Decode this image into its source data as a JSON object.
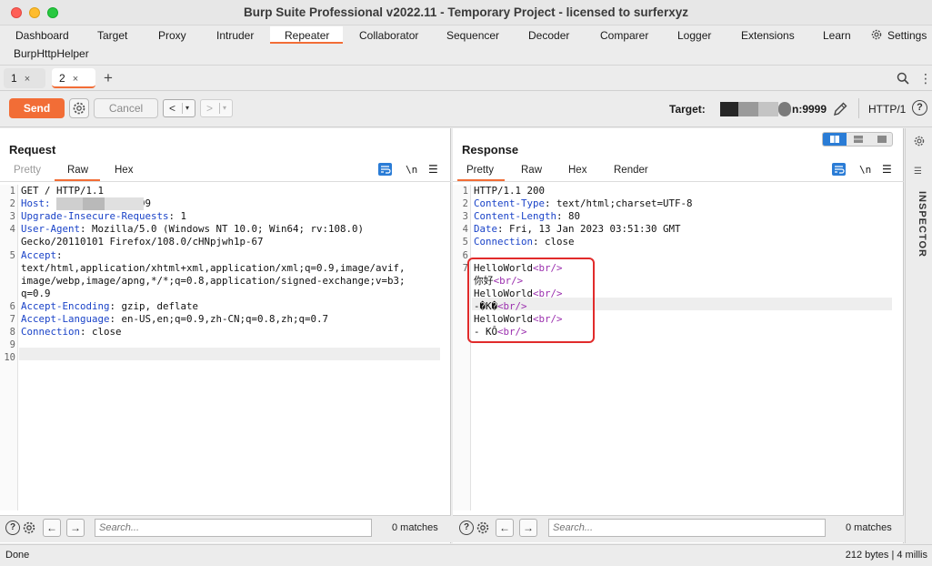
{
  "window": {
    "title": "Burp Suite Professional v2022.11 - Temporary Project - licensed to surferxyz"
  },
  "menu": {
    "tabs": [
      "Dashboard",
      "Target",
      "Proxy",
      "Intruder",
      "Repeater",
      "Collaborator",
      "Sequencer",
      "Decoder",
      "Comparer",
      "Logger",
      "Extensions",
      "Learn"
    ],
    "active": "Repeater",
    "settings_label": "Settings",
    "extension_tab": "BurpHttpHelper"
  },
  "repeater_tabs": [
    {
      "label": "1",
      "close": "×"
    },
    {
      "label": "2",
      "close": "×"
    }
  ],
  "toolbar": {
    "send_label": "Send",
    "cancel_label": "Cancel",
    "back_arrow": "<",
    "fwd_arrow": ">",
    "dropdown_glyph": "▾",
    "target_label": "Target:",
    "target_port": "n:9999",
    "http_version": "HTTP/1",
    "help_glyph": "?"
  },
  "request": {
    "title": "Request",
    "subtabs": [
      "Pretty",
      "Raw",
      "Hex"
    ],
    "active_subtab": "Raw",
    "newline_toggle": "\\n",
    "lines": [
      {
        "num": "1",
        "parts": [
          {
            "t": "GET / HTTP/1.1",
            "c": "plain"
          }
        ]
      },
      {
        "num": "2",
        "parts": [
          {
            "t": "Host: ",
            "c": "hdr"
          },
          {
            "t": "          n:9999",
            "c": "plain"
          }
        ]
      },
      {
        "num": "3",
        "parts": [
          {
            "t": "Upgrade-Insecure-Requests",
            "c": "hdr"
          },
          {
            "t": ": 1",
            "c": "plain"
          }
        ]
      },
      {
        "num": "4",
        "parts": [
          {
            "t": "User-Agent",
            "c": "hdr"
          },
          {
            "t": ": Mozilla/5.0 (Windows NT 10.0; Win64; rv:108.0)",
            "c": "plain"
          }
        ]
      },
      {
        "num": "",
        "parts": [
          {
            "t": "Gecko/20110101 Firefox/108.0/cHNpjwh1p-67",
            "c": "plain"
          }
        ]
      },
      {
        "num": "5",
        "parts": [
          {
            "t": "Accept",
            "c": "hdr"
          },
          {
            "t": ":",
            "c": "plain"
          }
        ]
      },
      {
        "num": "",
        "parts": [
          {
            "t": "text/html,application/xhtml+xml,application/xml;q=0.9,image/avif,",
            "c": "plain"
          }
        ]
      },
      {
        "num": "",
        "parts": [
          {
            "t": "image/webp,image/apng,*/*;q=0.8,application/signed-exchange;v=b3;",
            "c": "plain"
          }
        ]
      },
      {
        "num": "",
        "parts": [
          {
            "t": "q=0.9",
            "c": "plain"
          }
        ]
      },
      {
        "num": "6",
        "parts": [
          {
            "t": "Accept-Encoding",
            "c": "hdr"
          },
          {
            "t": ": gzip, deflate",
            "c": "plain"
          }
        ]
      },
      {
        "num": "7",
        "parts": [
          {
            "t": "Accept-Language",
            "c": "hdr"
          },
          {
            "t": ": en-US,en;q=0.9,zh-CN;q=0.8,zh;q=0.7",
            "c": "plain"
          }
        ]
      },
      {
        "num": "8",
        "parts": [
          {
            "t": "Connection",
            "c": "hdr"
          },
          {
            "t": ": close",
            "c": "plain"
          }
        ]
      },
      {
        "num": "9",
        "parts": []
      },
      {
        "num": "10",
        "parts": []
      }
    ],
    "search_placeholder": "Search...",
    "matches": "0 matches"
  },
  "response": {
    "title": "Response",
    "subtabs": [
      "Pretty",
      "Raw",
      "Hex",
      "Render"
    ],
    "active_subtab": "Pretty",
    "newline_toggle": "\\n",
    "lines": [
      {
        "num": "1",
        "parts": [
          {
            "t": "HTTP/1.1 200",
            "c": "plain"
          }
        ]
      },
      {
        "num": "2",
        "parts": [
          {
            "t": "Content-Type",
            "c": "hdr"
          },
          {
            "t": ": text/html;charset=UTF-8",
            "c": "plain"
          }
        ]
      },
      {
        "num": "3",
        "parts": [
          {
            "t": "Content-Length",
            "c": "hdr"
          },
          {
            "t": ": 80",
            "c": "plain"
          }
        ]
      },
      {
        "num": "4",
        "parts": [
          {
            "t": "Date",
            "c": "hdr"
          },
          {
            "t": ": Fri, 13 Jan 2023 03:51:30 GMT",
            "c": "plain"
          }
        ]
      },
      {
        "num": "5",
        "parts": [
          {
            "t": "Connection",
            "c": "hdr"
          },
          {
            "t": ": close",
            "c": "plain"
          }
        ]
      },
      {
        "num": "6",
        "parts": []
      },
      {
        "num": "7",
        "parts": [
          {
            "t": "HelloWorld",
            "c": "plain"
          },
          {
            "t": "<br/>",
            "c": "tag"
          }
        ]
      },
      {
        "num": "",
        "parts": [
          {
            "t": "你好",
            "c": "plain"
          },
          {
            "t": "<br/>",
            "c": "tag"
          }
        ]
      },
      {
        "num": "",
        "parts": [
          {
            "t": "HelloWorld",
            "c": "plain"
          },
          {
            "t": "<br/>",
            "c": "tag"
          }
        ]
      },
      {
        "num": "",
        "parts": [
          {
            "t": "-�K�",
            "c": "plain"
          },
          {
            "t": "<br/>",
            "c": "tag"
          }
        ]
      },
      {
        "num": "",
        "parts": [
          {
            "t": "HelloWorld",
            "c": "plain"
          },
          {
            "t": "<br/>",
            "c": "tag"
          }
        ]
      },
      {
        "num": "",
        "parts": [
          {
            "t": "- KÔ",
            "c": "plain"
          },
          {
            "t": "<br/>",
            "c": "tag"
          }
        ]
      }
    ],
    "search_placeholder": "Search...",
    "matches": "0 matches"
  },
  "inspector": {
    "label": "INSPECTOR"
  },
  "status": {
    "left": "Done",
    "right": "212 bytes | 4 millis"
  },
  "colors": {
    "accent": "#f26d36",
    "header_key": "#1a43c8",
    "html_tag": "#9b2fae",
    "highlight_box": "#e12b2b",
    "blue_icon": "#2a7cd6"
  }
}
